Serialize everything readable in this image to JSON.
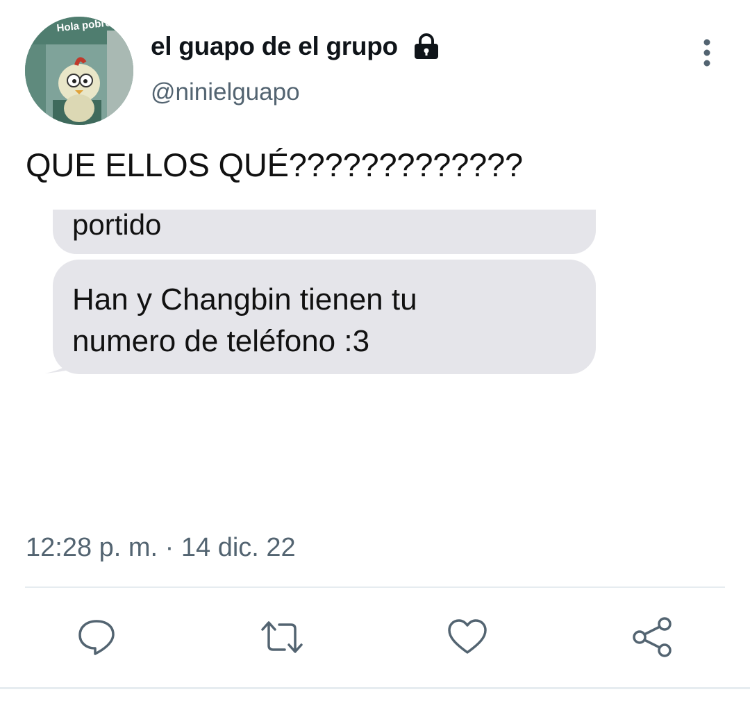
{
  "author": {
    "display_name": "el guapo de el grupo",
    "handle": "@ninielguapo",
    "avatar_caption": "Hola pobres",
    "protected_icon": "lock-icon"
  },
  "tweet": {
    "text": "QUE ELLOS QUÉ?????????????",
    "timestamp": "12:28 p. m. · 14 dic. 22"
  },
  "media": {
    "bubble_partial_text": "portido",
    "bubble_main_text": "Han y Changbin tienen tu\nnumero de teléfono :3",
    "bubble_color": "#e5e5ea"
  },
  "actions": [
    {
      "name": "reply",
      "icon": "comment-icon"
    },
    {
      "name": "retweet",
      "icon": "retweet-icon"
    },
    {
      "name": "like",
      "icon": "heart-icon"
    },
    {
      "name": "share",
      "icon": "share-icon"
    }
  ],
  "colors": {
    "text": "#0f1419",
    "secondary": "#536471",
    "icon": "#536471",
    "divider": "#e6ecf0"
  }
}
